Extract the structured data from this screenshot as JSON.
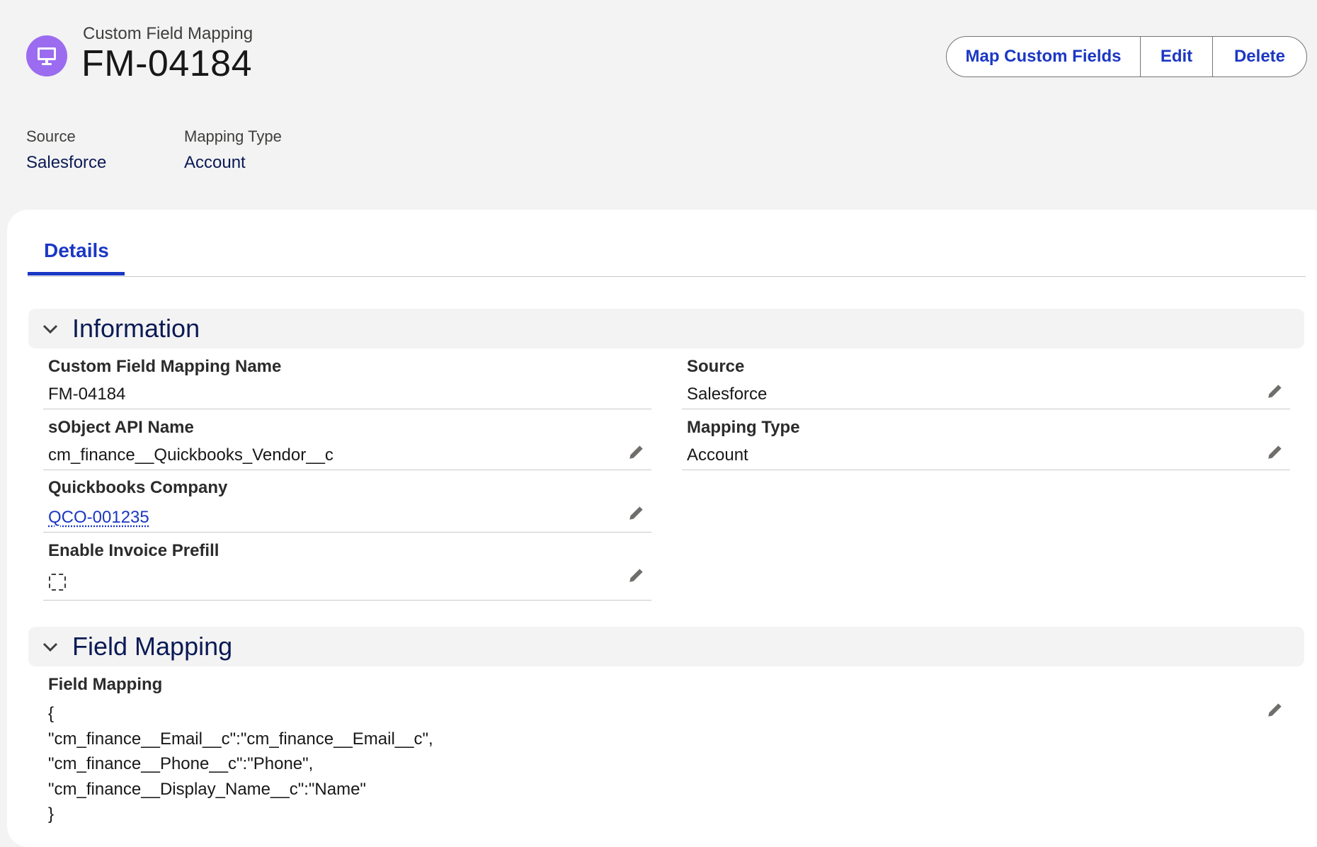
{
  "header": {
    "object_label": "Custom Field Mapping",
    "record_title": "FM-04184",
    "icon": "desktop-icon",
    "accent_color": "#9b6cf0",
    "buttons": {
      "map_custom_fields": "Map Custom Fields",
      "edit": "Edit",
      "delete": "Delete"
    }
  },
  "highlights": [
    {
      "label": "Source",
      "value": "Salesforce"
    },
    {
      "label": "Mapping Type",
      "value": "Account"
    }
  ],
  "tabs": [
    {
      "label": "Details",
      "active": true
    }
  ],
  "information": {
    "title": "Information",
    "fields": {
      "name": {
        "label": "Custom Field Mapping Name",
        "value": "FM-04184"
      },
      "source": {
        "label": "Source",
        "value": "Salesforce"
      },
      "sobject": {
        "label": "sObject API Name",
        "value": "cm_finance__Quickbooks_Vendor__c"
      },
      "mapping_type": {
        "label": "Mapping Type",
        "value": "Account"
      },
      "qb_company": {
        "label": "Quickbooks Company",
        "value": "QCO-001235"
      },
      "invoice_prefill": {
        "label": "Enable Invoice Prefill",
        "checked": false
      }
    }
  },
  "field_mapping": {
    "title": "Field Mapping",
    "label": "Field Mapping",
    "lines": [
      "{",
      "\"cm_finance__Email__c\":\"cm_finance__Email__c\",",
      "\"cm_finance__Phone__c\":\"Phone\",",
      "\"cm_finance__Display_Name__c\":\"Name\"",
      "}"
    ]
  }
}
